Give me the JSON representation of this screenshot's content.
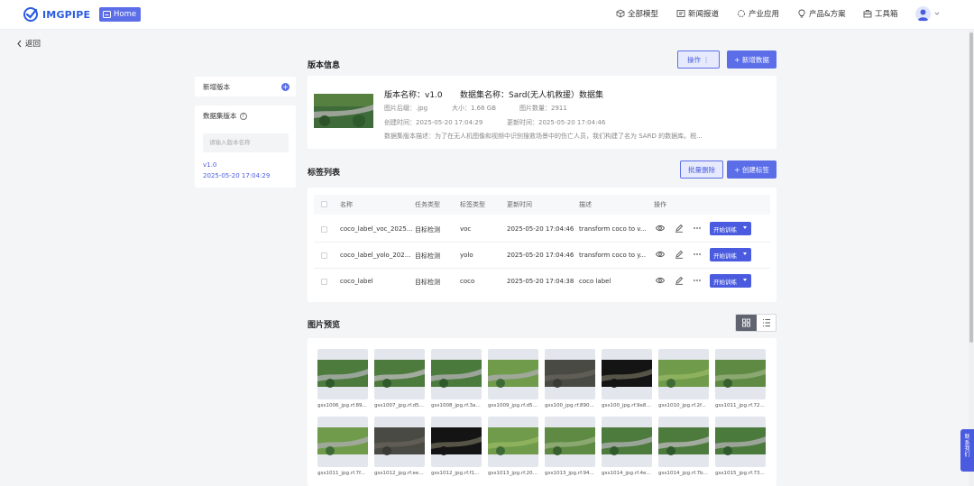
{
  "brand": {
    "name": "IMGPIPE",
    "home_label": "Home"
  },
  "nav": [
    "全部模型",
    "新闻报道",
    "产业应用",
    "产品&方案",
    "工具箱"
  ],
  "back_label": "返回",
  "left": {
    "add_version": "新增版本",
    "dataset_version_label": "数据集版本",
    "search_placeholder": "请输入版本名称",
    "versions": [
      {
        "name": "v1.0",
        "time": "2025-05-20 17:04:29"
      }
    ]
  },
  "version_info": {
    "title": "版本信息",
    "ops_button": "操作",
    "new_data_button": "新增数据",
    "name": "版本名称：v1.0",
    "dataset_name": "数据集名称：Sard(无人机救援）数据集",
    "ext": "图片后缀：.jpg",
    "size": "大小：1.66 GB",
    "count": "图片数量：2911",
    "created": "创建时间：2025-05-20 17:04:29",
    "updated": "更新时间：2025-05-20 17:04:46",
    "desc": "数据集版本描述：为了在无人机图像和视频中识别搜救场景中的伤亡人员，我们构建了名为 SARD 的数据库。税..."
  },
  "labels": {
    "title": "标签列表",
    "batch_delete": "批量删除",
    "create_label": "创建标签",
    "headers": [
      "名称",
      "任务类型",
      "标签类型",
      "更新时间",
      "描述",
      "操作"
    ],
    "rows": [
      {
        "name": "coco_label_voc_2025...",
        "task": "目标检测",
        "type": "voc",
        "time": "2025-05-20 17:04:46",
        "desc": "transform coco to v..."
      },
      {
        "name": "coco_label_yolo_202...",
        "task": "目标检测",
        "type": "yolo",
        "time": "2025-05-20 17:04:46",
        "desc": "transform coco to y..."
      },
      {
        "name": "coco_label",
        "task": "目标检测",
        "type": "coco",
        "time": "2025-05-20 17:04:38",
        "desc": "coco label"
      }
    ],
    "train_button": "开始训练"
  },
  "preview": {
    "title": "图片预览",
    "images": [
      "gss1006_jpg.rf.89...",
      "gss1007_jpg.rf.d5...",
      "gss1008_jpg.rf.3a...",
      "gss1009_jpg.rf.d5...",
      "gss100_jpg.rf.890...",
      "gss100_jpg.rf.9e8...",
      "gss1010_jpg.rf.2f...",
      "gss1011_jpg.rf.72...",
      "gss1011_jpg.rf.7f...",
      "gss1012_jpg.rf.ee...",
      "gss1012_jpg.rf.f1...",
      "gss1013_jpg.rf.20...",
      "gss1013_jpg.rf.94...",
      "gss1014_jpg.rf.4e...",
      "gss1014_jpg.rf.7b...",
      "gss1015_jpg.rf.73..."
    ]
  },
  "float_contact": "联系我们",
  "icons": [
    "logo-icon",
    "home-icon",
    "cube-icon",
    "news-icon",
    "industry-icon",
    "bulb-icon",
    "toolbox-icon",
    "user-icon",
    "eye-icon",
    "edit-icon",
    "more-icon",
    "grid-icon",
    "list-icon"
  ],
  "colors": {
    "accent": "#5b6ee8",
    "accent_dark": "#4a5be0",
    "bg": "#f4f5f7"
  }
}
